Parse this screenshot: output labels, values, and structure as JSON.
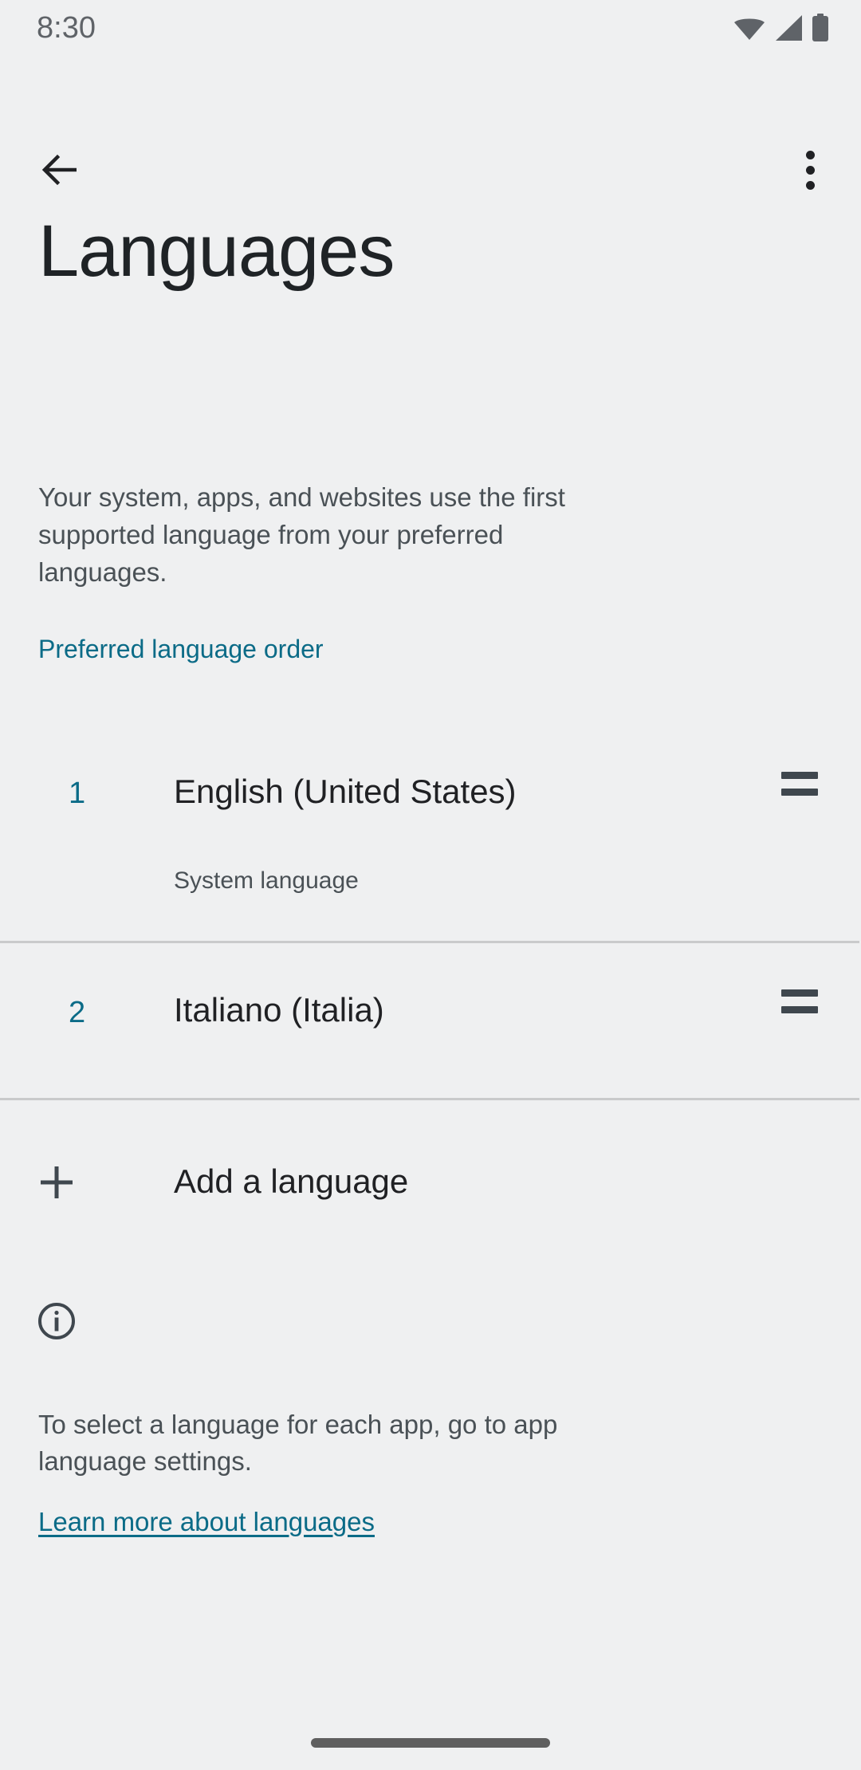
{
  "status_bar": {
    "time": "8:30",
    "icons": [
      "wifi-icon",
      "cellular-signal-icon",
      "battery-icon"
    ]
  },
  "action_bar": {
    "back_icon": "back-arrow-icon",
    "overflow_icon": "overflow-menu-icon"
  },
  "header": {
    "title": "Languages",
    "description": "Your system, apps, and websites use the first supported language from your preferred languages."
  },
  "section": {
    "header": "Preferred language order"
  },
  "languages": [
    {
      "index": "1",
      "name": "English (United States)",
      "subtitle": "System language",
      "drag_handle": "drag-handle-icon"
    },
    {
      "index": "2",
      "name": "Italiano (Italia)",
      "subtitle": "",
      "drag_handle": "drag-handle-icon"
    }
  ],
  "add_language": {
    "label": "Add a language",
    "icon": "plus-icon"
  },
  "footer": {
    "icon": "info-icon",
    "text": "To select a language for each app, go to app language settings.",
    "link": "Learn more about languages"
  },
  "colors": {
    "background": "#eff0f1",
    "accent": "#0b6b87",
    "primary_text": "#202124",
    "secondary_text": "#4a5156",
    "divider": "#c9cacb",
    "status_icon": "#5f6368",
    "drag_handle": "#3f474e"
  }
}
